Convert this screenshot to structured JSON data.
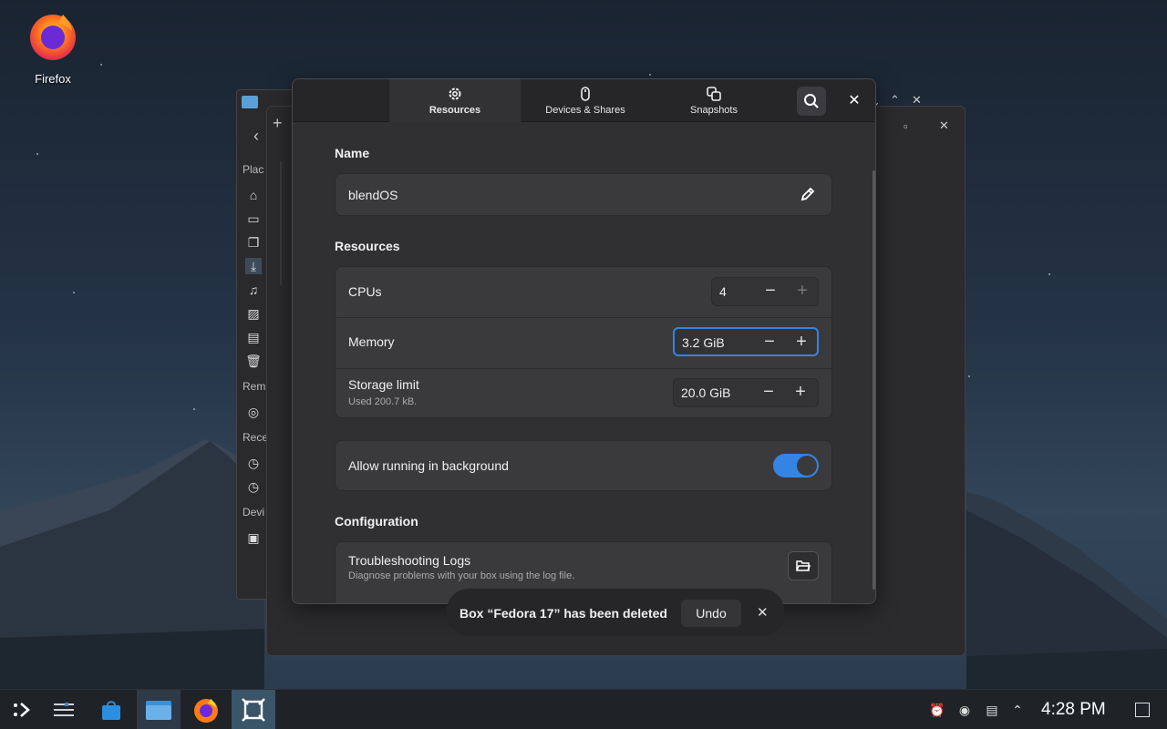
{
  "desktop": {
    "icons": [
      {
        "label": "Firefox",
        "icon": "firefox-icon"
      }
    ]
  },
  "files_window": {
    "sections": [
      "Plac",
      "Rem",
      "Rece",
      "Devi"
    ]
  },
  "dialog": {
    "tabs": [
      {
        "label": "Resources",
        "icon": "gear-icon",
        "active": true
      },
      {
        "label": "Devices & Shares",
        "icon": "mouse-icon",
        "active": false
      },
      {
        "label": "Snapshots",
        "icon": "snapshots-icon",
        "active": false
      }
    ],
    "name": {
      "title": "Name",
      "value": "blendOS"
    },
    "resources": {
      "title": "Resources",
      "cpus": {
        "label": "CPUs",
        "value": "4"
      },
      "memory": {
        "label": "Memory",
        "value": "3.2 GiB"
      },
      "storage": {
        "label": "Storage limit",
        "sublabel": "Used 200.7 kB.",
        "value": "20.0 GiB"
      }
    },
    "background": {
      "label": "Allow running in background",
      "enabled": true
    },
    "configuration": {
      "title": "Configuration",
      "logs": {
        "label": "Troubleshooting Logs",
        "sublabel": "Diagnose problems with your box using the log file."
      }
    }
  },
  "toast": {
    "message": "Box “Fedora 17” has been deleted",
    "undo_label": "Undo"
  },
  "taskbar": {
    "clock": "4:28 PM"
  },
  "colors": {
    "accent": "#3584e4",
    "dialog_bg": "#303033",
    "card_bg": "#3a3a3d",
    "taskbar_bg": "#1f2328"
  }
}
